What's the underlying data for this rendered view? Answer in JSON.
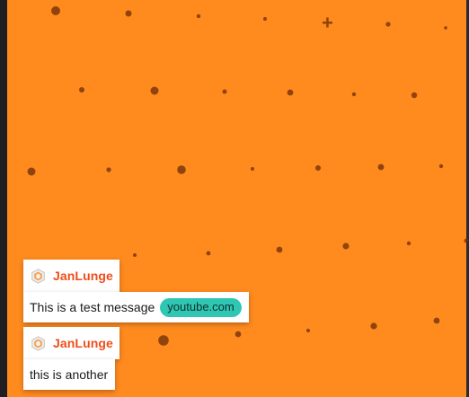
{
  "theme": {
    "background_color": "#ff8a1e",
    "username_color": "#ef4d19",
    "link_pill_color": "#2fc6b3"
  },
  "chat": {
    "messages": [
      {
        "username": "JanLunge",
        "badge_icon": "shield-badge-icon",
        "text": "This is a test message",
        "link": "youtube.com"
      },
      {
        "username": "JanLunge",
        "badge_icon": "shield-badge-icon",
        "text": "this is another"
      }
    ]
  }
}
